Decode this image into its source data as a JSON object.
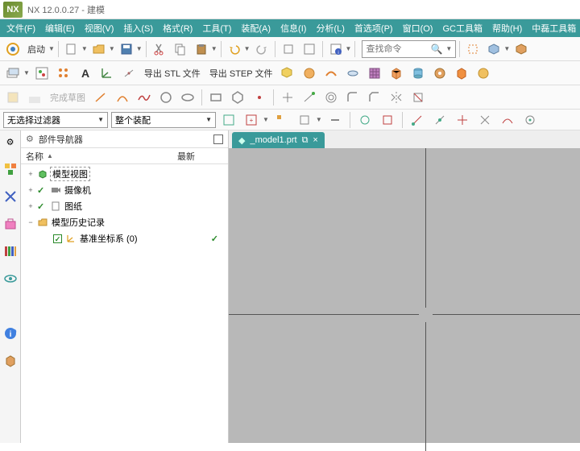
{
  "title": {
    "app": "NX",
    "version": "NX 12.0.0.27 - 建模"
  },
  "menu": [
    "文件(F)",
    "编辑(E)",
    "视图(V)",
    "插入(S)",
    "格式(R)",
    "工具(T)",
    "装配(A)",
    "信息(I)",
    "分析(L)",
    "首选项(P)",
    "窗口(O)",
    "GC工具箱",
    "帮助(H)",
    "中磊工具箱"
  ],
  "toolbar1": {
    "start": "启动"
  },
  "search": {
    "placeholder": "查找命令"
  },
  "toolbar2": {
    "export_stl": "导出 STL 文件",
    "export_step": "导出 STEP 文件"
  },
  "filters": {
    "filter1": "无选择过滤器",
    "filter2": "整个装配"
  },
  "navigator": {
    "gear": "⚙",
    "title": "部件导航器",
    "col_name": "名称",
    "col_latest": "最新",
    "tree": [
      {
        "exp": "+",
        "chk": "",
        "icon": "cube-green",
        "label": "模型视图",
        "dashed": true
      },
      {
        "exp": "+",
        "chk": "✓",
        "icon": "camera",
        "label": "摄像机"
      },
      {
        "exp": "+",
        "chk": "✓",
        "icon": "sheet",
        "label": "图纸"
      },
      {
        "exp": "−",
        "chk": "",
        "icon": "folder",
        "label": "模型历史记录"
      },
      {
        "exp": "",
        "chk": "☑",
        "icon": "csys",
        "label": "基准坐标系 (0)",
        "indent": 2,
        "latest": "✓"
      }
    ]
  },
  "tab": {
    "label": "_model1.prt",
    "icon": "⬢",
    "dup": "⧉"
  },
  "side_icons": [
    "gear",
    "assembly",
    "blue-x",
    "pink-box",
    "books",
    "eye",
    "blank",
    "info",
    "cube"
  ]
}
